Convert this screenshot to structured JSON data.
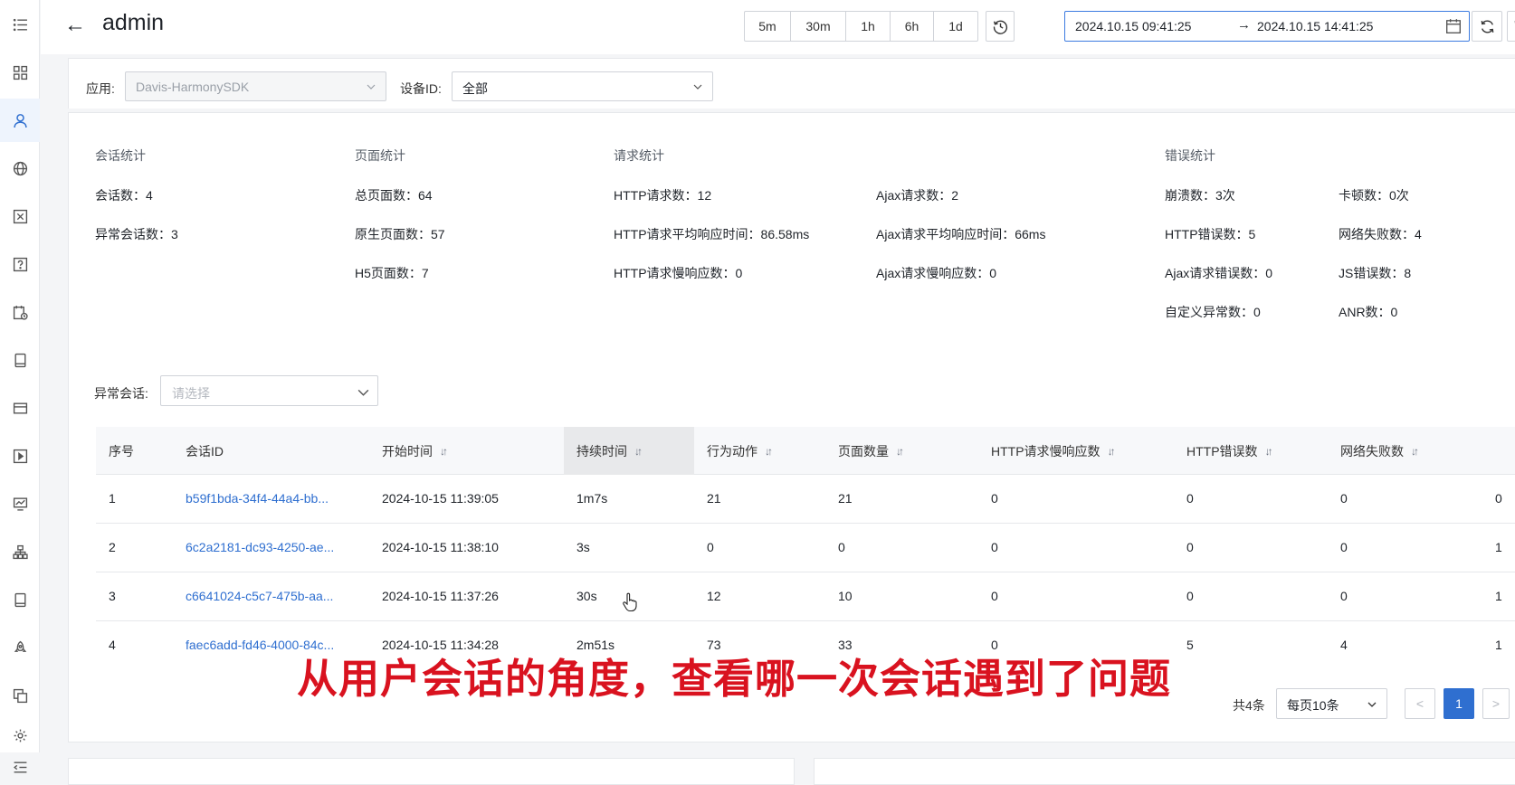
{
  "header": {
    "title": "admin",
    "time_ranges": [
      "5m",
      "30m",
      "1h",
      "6h",
      "1d"
    ],
    "date_start": "2024.10.15 09:41:25",
    "date_end": "2024.10.15 14:41:25",
    "date_arrow": "→"
  },
  "filters": {
    "app_label": "应用:",
    "app_value": "Davis-HarmonySDK",
    "device_label": "设备ID:",
    "device_value": "全部"
  },
  "stats": {
    "session": {
      "title": "会话统计",
      "items": [
        "会话数：4",
        "异常会话数：3"
      ]
    },
    "page": {
      "title": "页面统计",
      "items": [
        "总页面数：64",
        "原生页面数：57",
        "H5页面数：7"
      ]
    },
    "request": {
      "title": "请求统计",
      "items": [
        "HTTP请求数：12",
        "HTTP请求平均响应时间：86.58ms",
        "HTTP请求慢响应数：0"
      ],
      "items2": [
        "Ajax请求数：2",
        "Ajax请求平均响应时间：66ms",
        "Ajax请求慢响应数：0"
      ]
    },
    "error": {
      "title": "错误统计",
      "items": [
        "崩溃数：3次",
        "HTTP错误数：5",
        "Ajax请求错误数：0",
        "自定义异常数：0"
      ],
      "items2": [
        "卡顿数：0次",
        "网络失败数：4",
        "JS错误数：8",
        "ANR数：0"
      ]
    }
  },
  "abnormal": {
    "label": "异常会话:",
    "placeholder": "请选择"
  },
  "table": {
    "columns": [
      "序号",
      "会话ID",
      "开始时间",
      "持续时间",
      "行为动作",
      "页面数量",
      "HTTP请求慢响应数",
      "HTTP错误数",
      "网络失败数"
    ],
    "rows": [
      {
        "no": "1",
        "id": "b59f1bda-34f4-44a4-bb...",
        "start": "2024-10-15 11:39:05",
        "duration": "1m7s",
        "actions": "21",
        "pages": "21",
        "slow": "0",
        "http_err": "0",
        "net_fail": "0",
        "extra": "0"
      },
      {
        "no": "2",
        "id": "6c2a2181-dc93-4250-ae...",
        "start": "2024-10-15 11:38:10",
        "duration": "3s",
        "actions": "0",
        "pages": "0",
        "slow": "0",
        "http_err": "0",
        "net_fail": "0",
        "extra": "1"
      },
      {
        "no": "3",
        "id": "c6641024-c5c7-475b-aa...",
        "start": "2024-10-15 11:37:26",
        "duration": "30s",
        "actions": "12",
        "pages": "10",
        "slow": "0",
        "http_err": "0",
        "net_fail": "0",
        "extra": "1"
      },
      {
        "no": "4",
        "id": "faec6add-fd46-4000-84c...",
        "start": "2024-10-15 11:34:28",
        "duration": "2m51s",
        "actions": "73",
        "pages": "33",
        "slow": "0",
        "http_err": "5",
        "net_fail": "4",
        "extra": "1"
      }
    ]
  },
  "pagination": {
    "total": "共4条",
    "page_size": "每页10条",
    "prev": "<",
    "current": "1",
    "next": ">"
  },
  "subtitle": "从用户会话的角度，查看哪一次会话遇到了问题",
  "colors": {
    "accent": "#2f6fd0",
    "subtitle": "#d9121f"
  }
}
